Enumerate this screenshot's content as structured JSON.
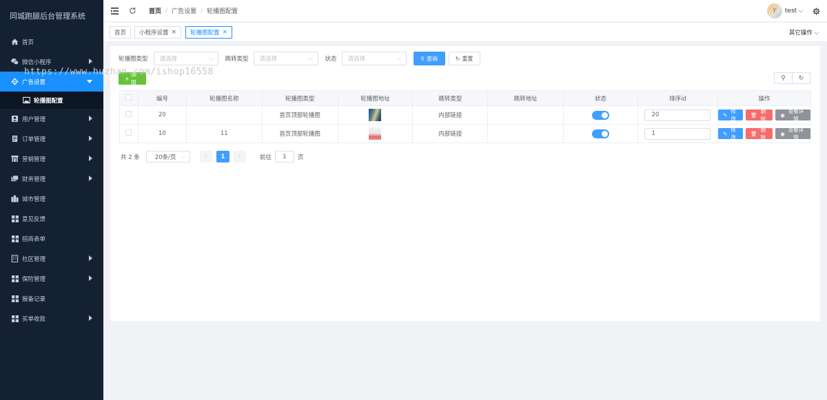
{
  "app": {
    "title": "同城跑腿后台管理系统"
  },
  "sidebar": {
    "items": [
      {
        "label": "首页",
        "icon": "home-icon",
        "has_arrow": false
      },
      {
        "label": "微信小程序",
        "icon": "wechat-icon",
        "has_arrow": true
      },
      {
        "label": "广告设置",
        "icon": "gear-icon",
        "has_arrow": true,
        "active": true
      },
      {
        "label": "用户管理",
        "icon": "user-card-icon",
        "has_arrow": true
      },
      {
        "label": "订单管理",
        "icon": "order-icon",
        "has_arrow": true
      },
      {
        "label": "营销管理",
        "icon": "shop-icon",
        "has_arrow": true
      },
      {
        "label": "财务管理",
        "icon": "finance-icon",
        "has_arrow": true
      },
      {
        "label": "城市管理",
        "icon": "city-icon",
        "has_arrow": false
      },
      {
        "label": "意见反馈",
        "icon": "grid-icon",
        "has_arrow": false
      },
      {
        "label": "招商表单",
        "icon": "grid-icon",
        "has_arrow": false
      },
      {
        "label": "社区管理",
        "icon": "building-icon",
        "has_arrow": true
      },
      {
        "label": "保险管理",
        "icon": "grid-icon",
        "has_arrow": true
      },
      {
        "label": "报备记录",
        "icon": "grid-icon",
        "has_arrow": false
      },
      {
        "label": "买单收款",
        "icon": "grid-icon",
        "has_arrow": true
      }
    ],
    "sub_item": {
      "label": "轮播图配置",
      "icon": "image-icon"
    }
  },
  "header": {
    "breadcrumb": [
      "首页",
      "广告设置",
      "轮播图配置"
    ],
    "user_name": "test",
    "avatar_text": "Y"
  },
  "tags": [
    {
      "label": "首页",
      "closable": false
    },
    {
      "label": "小程序设置",
      "closable": true
    },
    {
      "label": "轮播图配置",
      "closable": true,
      "active": true
    }
  ],
  "other_ops": "其它操作",
  "search": {
    "type_label": "轮播图类型",
    "type_placeholder": "请选择",
    "jump_label": "跳转类型",
    "jump_placeholder": "请选择",
    "status_label": "状态",
    "status_placeholder": "请选择",
    "query_button": "查询",
    "reset_button": "重置"
  },
  "add_button": "添加",
  "table": {
    "columns": [
      "编号",
      "轮播图名称",
      "轮播图类型",
      "轮播图地址",
      "跳转类型",
      "跳转地址",
      "状态",
      "排序id",
      "操作"
    ],
    "rows": [
      {
        "id": "20",
        "name": "",
        "type": "首页顶部轮播图",
        "jump_type": "内部链接",
        "jump_url": "",
        "status_on": true,
        "sort": "20"
      },
      {
        "id": "10",
        "name": "11",
        "type": "首页顶部轮播图",
        "jump_type": "内部链接",
        "jump_url": "",
        "status_on": true,
        "sort": "1"
      }
    ],
    "op_labels": {
      "edit": "修改",
      "delete": "删除",
      "detail": "查看详情"
    }
  },
  "pagination": {
    "total_text": "共 2 条",
    "page_size": "20条/页",
    "current_page": "1",
    "goto_label": "前往",
    "goto_value": "1",
    "page_unit": "页"
  },
  "watermark": "https://www.huzhan.com/ishop16558",
  "colors": {
    "sidebar_bg": "#142133",
    "active": "#1890ff",
    "primary": "#409eff",
    "success": "#67c23a",
    "danger": "#f56c6c",
    "info": "#909399"
  }
}
